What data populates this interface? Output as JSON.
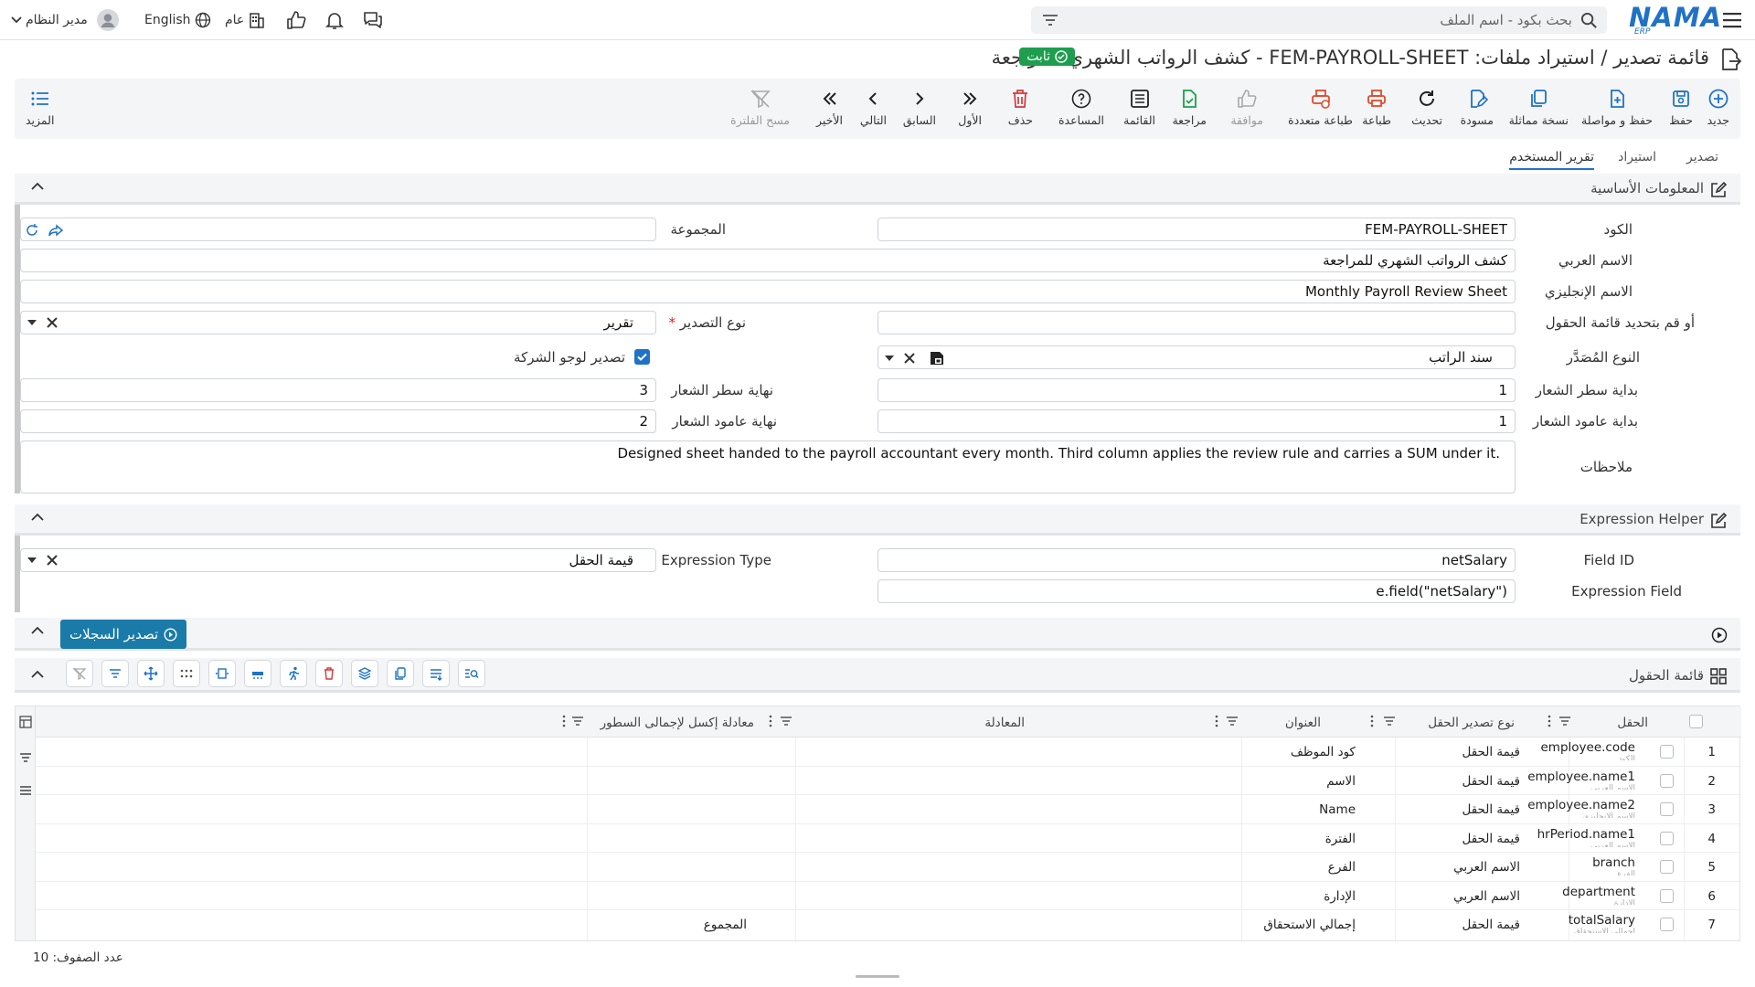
{
  "topbar": {
    "logo": "NAMA",
    "logo_sub": "ERP",
    "search_placeholder": "بحث بكود - اسم الملف",
    "user_name": "مدير النظام",
    "language": "English",
    "scope": "عام"
  },
  "title": {
    "text": "قائمة تصدير / استيراد ملفات: FEM-PAYROLL-SHEET - كشف الرواتب الشهري للمراجعة",
    "badge": "ثابت"
  },
  "toolbar": {
    "more": "المزيد",
    "buttons": [
      {
        "label": "جديد",
        "icon": "plus-circle-icon"
      },
      {
        "label": "حفظ",
        "icon": "save-icon"
      },
      {
        "label": "حفظ و مواصلة",
        "icon": "save-continue-icon"
      },
      {
        "label": "نسخة مماثلة",
        "icon": "copy-icon"
      },
      {
        "label": "مسودة",
        "icon": "draft-icon"
      },
      {
        "label": "تحديث",
        "icon": "refresh-icon"
      },
      {
        "label": "طباعة",
        "icon": "print-icon"
      },
      {
        "label": "طباعة متعددة",
        "icon": "multi-print-icon"
      },
      {
        "label": "موافقة",
        "icon": "thumbs-up-icon"
      },
      {
        "label": "مراجعة",
        "icon": "review-icon"
      },
      {
        "label": "القائمة",
        "icon": "list-icon"
      },
      {
        "label": "المساعدة",
        "icon": "help-icon"
      },
      {
        "label": "حذف",
        "icon": "trash-icon"
      },
      {
        "label": "الأول",
        "icon": "first-icon"
      },
      {
        "label": "السابق",
        "icon": "previous-icon"
      },
      {
        "label": "التالي",
        "icon": "next-icon"
      },
      {
        "label": "الأخير",
        "icon": "last-icon"
      },
      {
        "label": "مسح الفلترة",
        "icon": "clear-filter-icon"
      }
    ]
  },
  "tabs": [
    "تصدير",
    "استيراد",
    "تقرير المستخدم"
  ],
  "basic": {
    "section_title": "المعلومات الأساسية",
    "code_label": "الكود",
    "code_value": "FEM-PAYROLL-SHEET",
    "group_label": "المجموعة",
    "group_value": "",
    "arabic_name_label": "الاسم العربي",
    "arabic_name_value": "كشف الرواتب الشهري للمراجعة",
    "english_name_label": "الاسم الإنجليزي",
    "english_name_value": "Monthly Payroll Review Sheet",
    "fields_list_label": "أو قم بتحديد قائمة الحقول",
    "fields_list_value": "",
    "export_type_label": "نوع التصدير",
    "required_mark": "*",
    "export_type_value": "تقرير",
    "source_type_label": "النوع المُصَدَّر",
    "source_type_value": "سند الراتب",
    "logo_export_label": "تصدير لوجو الشركة",
    "logo_row_start_label": "بداية سطر الشعار",
    "logo_row_start_value": "1",
    "logo_row_end_label": "نهاية سطر الشعار",
    "logo_row_end_value": "3",
    "logo_col_start_label": "بداية عامود الشعار",
    "logo_col_start_value": "1",
    "logo_col_end_label": "نهاية عامود الشعار",
    "logo_col_end_value": "2",
    "notes_label": "ملاحظات",
    "notes_value": "Designed sheet handed to the payroll accountant every month. Third column applies the review rule and carries a SUM under it."
  },
  "expr": {
    "section_title": "Expression Helper",
    "field_id_label": "Field ID",
    "field_id_value": "netSalary",
    "expr_type_label": "Expression Type",
    "expr_type_value": "قيمة الحقل",
    "expr_field_label": "Expression Field",
    "expr_field_value": "e.field(\"netSalary\")"
  },
  "export_records_button": "تصدير السجلات",
  "fields_section_title": "قائمة الحقول",
  "grid": {
    "columns": [
      "الحقل",
      "نوع تصدير الحقل",
      "العنوان",
      "المعادلة",
      "معادلة إكسل لإجمالى السطور"
    ],
    "rows": [
      {
        "num": "1",
        "field": "employee.code",
        "sub": "الكود",
        "type": "قيمة الحقل",
        "title": "كود الموظف",
        "formula": "",
        "excel": ""
      },
      {
        "num": "2",
        "field": "employee.name1",
        "sub": "الاسم العربي",
        "type": "قيمة الحقل",
        "title": "الاسم",
        "formula": "",
        "excel": ""
      },
      {
        "num": "3",
        "field": "employee.name2",
        "sub": "الاسم الإنجليزي",
        "type": "قيمة الحقل",
        "title": "Name",
        "formula": "",
        "excel": ""
      },
      {
        "num": "4",
        "field": "hrPeriod.name1",
        "sub": "الاسم العربي",
        "type": "قيمة الحقل",
        "title": "الفترة",
        "formula": "",
        "excel": ""
      },
      {
        "num": "5",
        "field": "branch",
        "sub": "الفرع",
        "type": "الاسم العربي",
        "title": "الفرع",
        "formula": "",
        "excel": ""
      },
      {
        "num": "6",
        "field": "department",
        "sub": "الإدارة",
        "type": "الاسم العربي",
        "title": "الإدارة",
        "formula": "",
        "excel": ""
      },
      {
        "num": "7",
        "field": "totalSalary",
        "sub": "إجمالي الاستحقاق",
        "type": "قيمة الحقل",
        "title": "إجمالي الاستحقاق",
        "formula": "",
        "excel": "المجموع"
      }
    ]
  },
  "footer": {
    "row_count": "عدد الصفوف: 10"
  },
  "colors": {
    "primary": "#1f72c6",
    "success": "#1e9e4e",
    "danger": "#d23a3a",
    "export_btn": "#1a7aa8"
  }
}
